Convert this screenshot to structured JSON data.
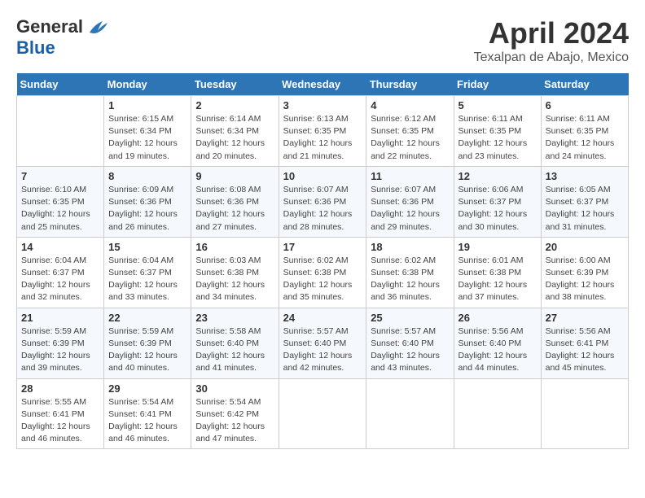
{
  "logo": {
    "general": "General",
    "blue": "Blue"
  },
  "title": "April 2024",
  "location": "Texalpan de Abajo, Mexico",
  "days_header": [
    "Sunday",
    "Monday",
    "Tuesday",
    "Wednesday",
    "Thursday",
    "Friday",
    "Saturday"
  ],
  "weeks": [
    [
      {
        "num": "",
        "info": ""
      },
      {
        "num": "1",
        "info": "Sunrise: 6:15 AM\nSunset: 6:34 PM\nDaylight: 12 hours\nand 19 minutes."
      },
      {
        "num": "2",
        "info": "Sunrise: 6:14 AM\nSunset: 6:34 PM\nDaylight: 12 hours\nand 20 minutes."
      },
      {
        "num": "3",
        "info": "Sunrise: 6:13 AM\nSunset: 6:35 PM\nDaylight: 12 hours\nand 21 minutes."
      },
      {
        "num": "4",
        "info": "Sunrise: 6:12 AM\nSunset: 6:35 PM\nDaylight: 12 hours\nand 22 minutes."
      },
      {
        "num": "5",
        "info": "Sunrise: 6:11 AM\nSunset: 6:35 PM\nDaylight: 12 hours\nand 23 minutes."
      },
      {
        "num": "6",
        "info": "Sunrise: 6:11 AM\nSunset: 6:35 PM\nDaylight: 12 hours\nand 24 minutes."
      }
    ],
    [
      {
        "num": "7",
        "info": "Sunrise: 6:10 AM\nSunset: 6:35 PM\nDaylight: 12 hours\nand 25 minutes."
      },
      {
        "num": "8",
        "info": "Sunrise: 6:09 AM\nSunset: 6:36 PM\nDaylight: 12 hours\nand 26 minutes."
      },
      {
        "num": "9",
        "info": "Sunrise: 6:08 AM\nSunset: 6:36 PM\nDaylight: 12 hours\nand 27 minutes."
      },
      {
        "num": "10",
        "info": "Sunrise: 6:07 AM\nSunset: 6:36 PM\nDaylight: 12 hours\nand 28 minutes."
      },
      {
        "num": "11",
        "info": "Sunrise: 6:07 AM\nSunset: 6:36 PM\nDaylight: 12 hours\nand 29 minutes."
      },
      {
        "num": "12",
        "info": "Sunrise: 6:06 AM\nSunset: 6:37 PM\nDaylight: 12 hours\nand 30 minutes."
      },
      {
        "num": "13",
        "info": "Sunrise: 6:05 AM\nSunset: 6:37 PM\nDaylight: 12 hours\nand 31 minutes."
      }
    ],
    [
      {
        "num": "14",
        "info": "Sunrise: 6:04 AM\nSunset: 6:37 PM\nDaylight: 12 hours\nand 32 minutes."
      },
      {
        "num": "15",
        "info": "Sunrise: 6:04 AM\nSunset: 6:37 PM\nDaylight: 12 hours\nand 33 minutes."
      },
      {
        "num": "16",
        "info": "Sunrise: 6:03 AM\nSunset: 6:38 PM\nDaylight: 12 hours\nand 34 minutes."
      },
      {
        "num": "17",
        "info": "Sunrise: 6:02 AM\nSunset: 6:38 PM\nDaylight: 12 hours\nand 35 minutes."
      },
      {
        "num": "18",
        "info": "Sunrise: 6:02 AM\nSunset: 6:38 PM\nDaylight: 12 hours\nand 36 minutes."
      },
      {
        "num": "19",
        "info": "Sunrise: 6:01 AM\nSunset: 6:38 PM\nDaylight: 12 hours\nand 37 minutes."
      },
      {
        "num": "20",
        "info": "Sunrise: 6:00 AM\nSunset: 6:39 PM\nDaylight: 12 hours\nand 38 minutes."
      }
    ],
    [
      {
        "num": "21",
        "info": "Sunrise: 5:59 AM\nSunset: 6:39 PM\nDaylight: 12 hours\nand 39 minutes."
      },
      {
        "num": "22",
        "info": "Sunrise: 5:59 AM\nSunset: 6:39 PM\nDaylight: 12 hours\nand 40 minutes."
      },
      {
        "num": "23",
        "info": "Sunrise: 5:58 AM\nSunset: 6:40 PM\nDaylight: 12 hours\nand 41 minutes."
      },
      {
        "num": "24",
        "info": "Sunrise: 5:57 AM\nSunset: 6:40 PM\nDaylight: 12 hours\nand 42 minutes."
      },
      {
        "num": "25",
        "info": "Sunrise: 5:57 AM\nSunset: 6:40 PM\nDaylight: 12 hours\nand 43 minutes."
      },
      {
        "num": "26",
        "info": "Sunrise: 5:56 AM\nSunset: 6:40 PM\nDaylight: 12 hours\nand 44 minutes."
      },
      {
        "num": "27",
        "info": "Sunrise: 5:56 AM\nSunset: 6:41 PM\nDaylight: 12 hours\nand 45 minutes."
      }
    ],
    [
      {
        "num": "28",
        "info": "Sunrise: 5:55 AM\nSunset: 6:41 PM\nDaylight: 12 hours\nand 46 minutes."
      },
      {
        "num": "29",
        "info": "Sunrise: 5:54 AM\nSunset: 6:41 PM\nDaylight: 12 hours\nand 46 minutes."
      },
      {
        "num": "30",
        "info": "Sunrise: 5:54 AM\nSunset: 6:42 PM\nDaylight: 12 hours\nand 47 minutes."
      },
      {
        "num": "",
        "info": ""
      },
      {
        "num": "",
        "info": ""
      },
      {
        "num": "",
        "info": ""
      },
      {
        "num": "",
        "info": ""
      }
    ]
  ]
}
